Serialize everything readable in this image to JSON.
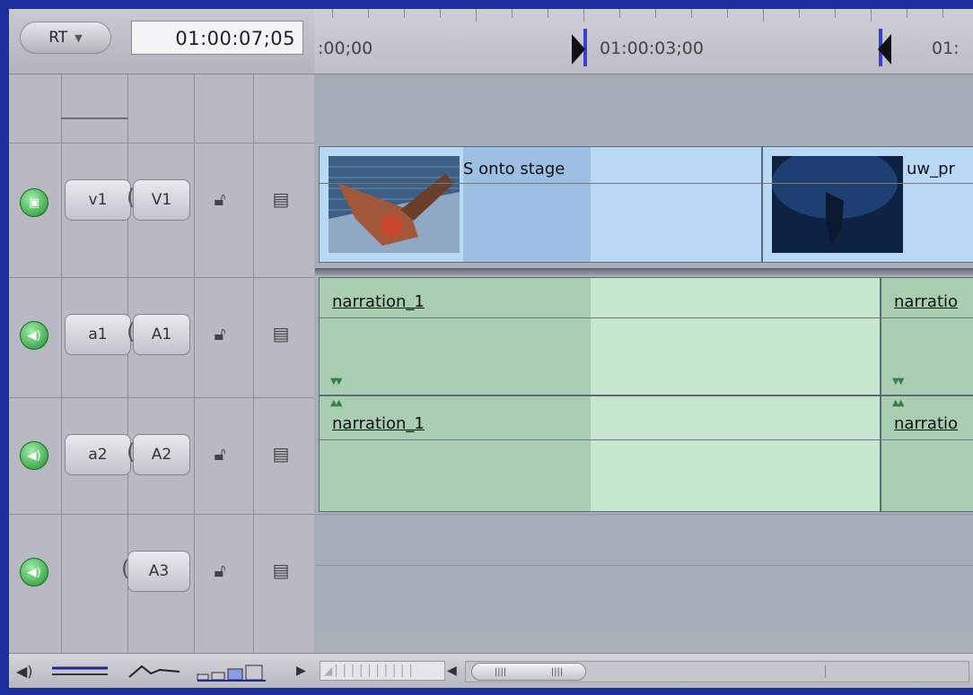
{
  "header": {
    "rt_label": "RT",
    "current_timecode": "01:00:07;05"
  },
  "ruler": {
    "labels": [
      ":00;00",
      "01:00:03;00",
      "01:"
    ]
  },
  "tracks": {
    "v1": {
      "source": "v1",
      "dest": "V1"
    },
    "a1": {
      "source": "a1",
      "dest": "A1"
    },
    "a2": {
      "source": "a2",
      "dest": "A2"
    },
    "a3": {
      "dest": "A3"
    }
  },
  "clips": {
    "v1_clip1": "S onto stage",
    "v1_clip2": "uw_pr",
    "a1_clip1": "narration_1",
    "a1_clip2": "narratio",
    "a2_clip1": "narration_1",
    "a2_clip2": "narratio"
  },
  "colors": {
    "video_clip": "#b9d8f3",
    "audio_clip": "#c4e7cd",
    "track_on_green": "#1f8d2e",
    "frame_border": "#1c2f9e"
  }
}
